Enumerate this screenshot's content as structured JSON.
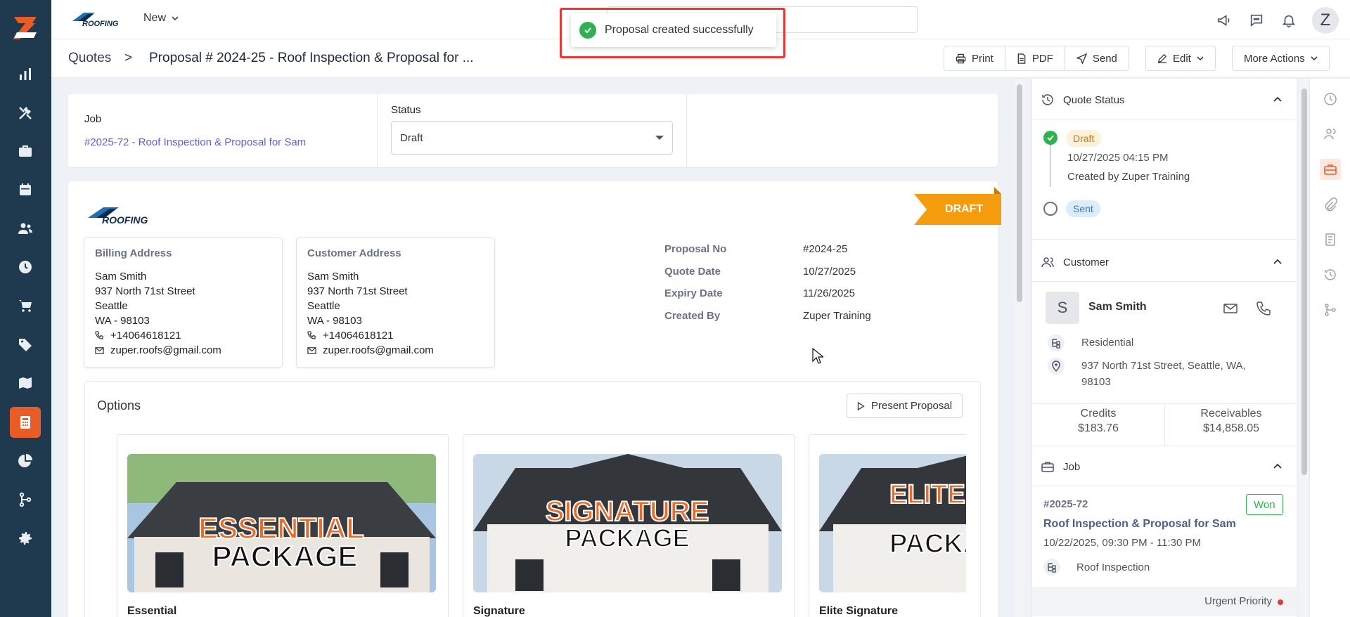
{
  "topbar": {
    "new_label": "New",
    "brand_alt": "ROOFING",
    "avatar_letter": "Z"
  },
  "toast": {
    "message": "Proposal created successfully"
  },
  "breadcrumb": {
    "root": "Quotes",
    "separator": ">",
    "title": "Proposal # 2024-25 - Roof Inspection & Proposal for ..."
  },
  "actions": {
    "print": "Print",
    "pdf": "PDF",
    "send": "Send",
    "edit": "Edit",
    "more": "More Actions"
  },
  "job_card": {
    "job_label": "Job",
    "job_link": "#2025-72 - Roof Inspection & Proposal for Sam",
    "status_label": "Status",
    "status_value": "Draft"
  },
  "document": {
    "logo_text": "ROOFING",
    "ribbon": "DRAFT",
    "billing": {
      "title": "Billing Address",
      "name": "Sam Smith",
      "street": "937 North 71st Street",
      "city": "Seattle",
      "state_zip": "WA - 98103",
      "phone": "+14064618121",
      "email": "zuper.roofs@gmail.com"
    },
    "customer": {
      "title": "Customer Address",
      "name": "Sam Smith",
      "street": "937 North 71st Street",
      "city": "Seattle",
      "state_zip": "WA - 98103",
      "phone": "+14064618121",
      "email": "zuper.roofs@gmail.com"
    },
    "meta": [
      {
        "k": "Proposal No",
        "v": "#2024-25"
      },
      {
        "k": "Quote Date",
        "v": "10/27/2025"
      },
      {
        "k": "Expiry Date",
        "v": "11/26/2025"
      },
      {
        "k": "Created By",
        "v": "Zuper Training"
      }
    ],
    "options": {
      "title": "Options",
      "present_button": "Present Proposal",
      "packages": [
        {
          "name": "Essential",
          "banner_line1": "ESSENTIAL",
          "banner_line2": "PACKAGE"
        },
        {
          "name": "Signature",
          "banner_line1": "SIGNATURE",
          "banner_line2": "PACKAGE"
        },
        {
          "name": "Elite Signature",
          "banner_line1": "ELITE SIGNATURE",
          "banner_line2": "PACKAGE"
        }
      ]
    }
  },
  "right_panel": {
    "quote_status": {
      "title": "Quote Status",
      "step1_badge": "Draft",
      "step1_time": "10/27/2025 04:15 PM",
      "step1_by": "Created by Zuper Training",
      "step2_badge": "Sent"
    },
    "customer": {
      "title": "Customer",
      "avatar": "S",
      "name": "Sam Smith",
      "type": "Residential",
      "address_line1": "937 North 71st Street, Seattle, WA,",
      "address_line2": "98103",
      "credits_label": "Credits",
      "credits_value": "$183.76",
      "receivables_label": "Receivables",
      "receivables_value": "$14,858.05"
    },
    "job": {
      "title": "Job",
      "number": "#2025-72",
      "badge": "Won",
      "name": "Roof Inspection & Proposal for Sam",
      "time": "10/22/2025, 09:30 PM - 11:30 PM",
      "category": "Roof Inspection",
      "priority": "Urgent Priority"
    }
  },
  "colors": {
    "rail": "#1f3a4e",
    "accent": "#ea5b26",
    "draft": "#f59c0e",
    "success": "#2eb24f",
    "link": "#5b63d8"
  }
}
